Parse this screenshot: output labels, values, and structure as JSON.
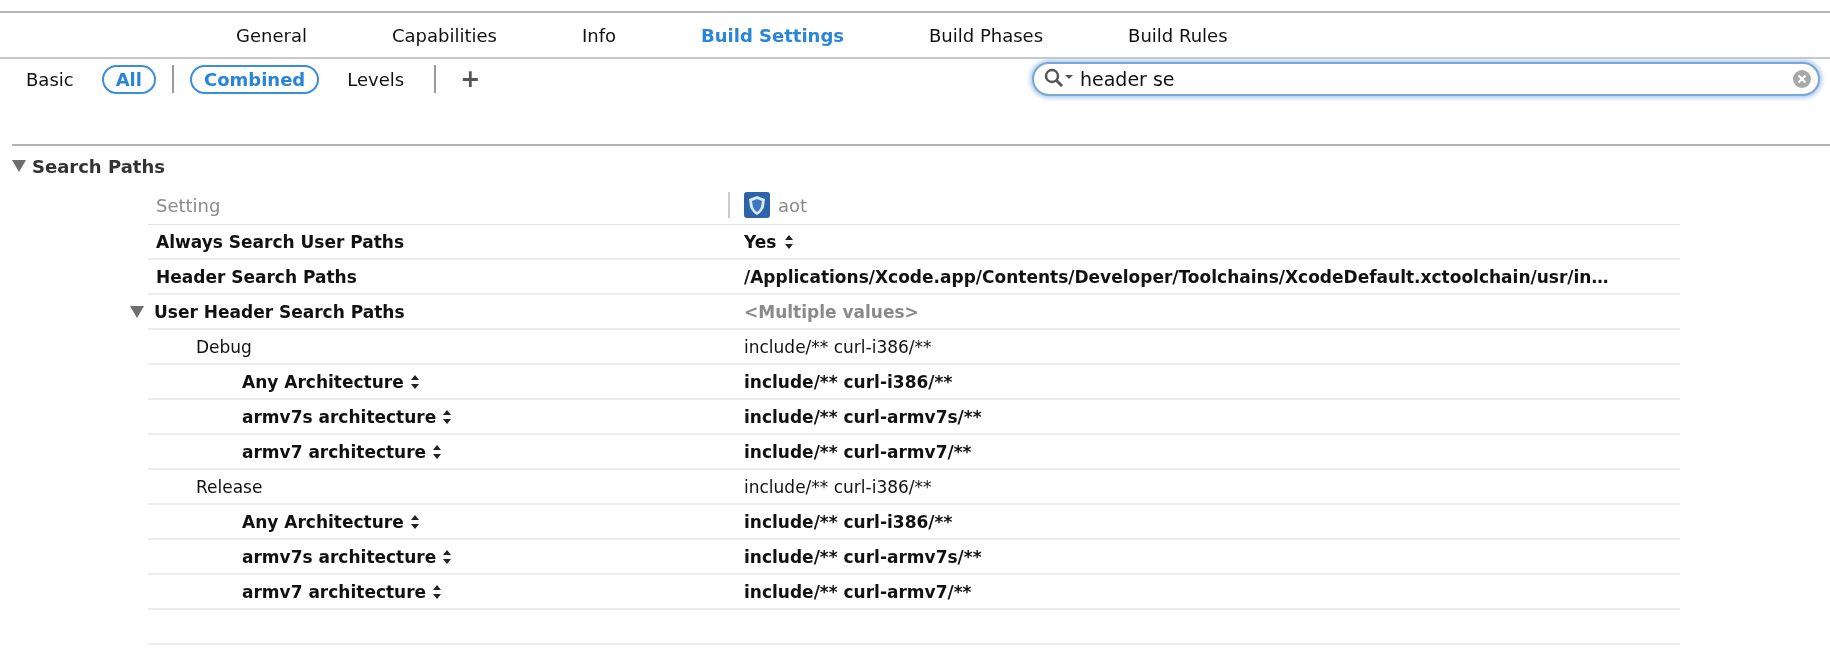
{
  "tabs": [
    {
      "label": "General",
      "selected": false
    },
    {
      "label": "Capabilities",
      "selected": false
    },
    {
      "label": "Info",
      "selected": false
    },
    {
      "label": "Build Settings",
      "selected": true
    },
    {
      "label": "Build Phases",
      "selected": false
    },
    {
      "label": "Build Rules",
      "selected": false
    }
  ],
  "filter_groups": [
    [
      {
        "label": "Basic",
        "selected": false
      },
      {
        "label": "All",
        "selected": true
      }
    ],
    [
      {
        "label": "Combined",
        "selected": true
      },
      {
        "label": "Levels",
        "selected": false
      }
    ]
  ],
  "add_button": "+",
  "search": {
    "value": "header se"
  },
  "section": {
    "title": "Search Paths",
    "expanded": true,
    "column_header": {
      "setting": "Setting",
      "target": "aot"
    },
    "rows": [
      {
        "kind": "setting",
        "name": "Always Search User Paths",
        "value": "Yes",
        "value_bold": true,
        "value_dimmed": false,
        "popup": true
      },
      {
        "kind": "setting",
        "name": "Header Search Paths",
        "value": "/Applications/Xcode.app/Contents/Developer/Toolchains/XcodeDefault.xctoolchain/usr/in…",
        "value_bold": true,
        "value_dimmed": false,
        "popup": false
      },
      {
        "kind": "setting",
        "name": "User Header Search Paths",
        "value": "<Multiple values>",
        "value_bold": true,
        "value_dimmed": true,
        "popup": false,
        "expanded": true,
        "children": [
          {
            "kind": "configuration",
            "name": "Debug",
            "value": "include/** curl-i386/**",
            "value_bold": false,
            "value_dimmed": false,
            "popup": false,
            "children": [
              {
                "kind": "architecture",
                "name": "Any Architecture",
                "value": "include/** curl-i386/**",
                "value_bold": true,
                "value_dimmed": false,
                "popup": false
              },
              {
                "kind": "architecture",
                "name": "armv7s architecture",
                "value": "include/** curl-armv7s/**",
                "value_bold": true,
                "value_dimmed": false,
                "popup": false
              },
              {
                "kind": "architecture",
                "name": "armv7 architecture",
                "value": "include/** curl-armv7/**",
                "value_bold": true,
                "value_dimmed": false,
                "popup": false
              }
            ]
          },
          {
            "kind": "configuration",
            "name": "Release",
            "value": "include/** curl-i386/**",
            "value_bold": false,
            "value_dimmed": false,
            "popup": false,
            "children": [
              {
                "kind": "architecture",
                "name": "Any Architecture",
                "value": "include/** curl-i386/**",
                "value_bold": true,
                "value_dimmed": false,
                "popup": false
              },
              {
                "kind": "architecture",
                "name": "armv7s architecture",
                "value": "include/** curl-armv7s/**",
                "value_bold": true,
                "value_dimmed": false,
                "popup": false
              },
              {
                "kind": "architecture",
                "name": "armv7 architecture",
                "value": "include/** curl-armv7/**",
                "value_bold": true,
                "value_dimmed": false,
                "popup": false
              }
            ]
          }
        ]
      }
    ]
  }
}
